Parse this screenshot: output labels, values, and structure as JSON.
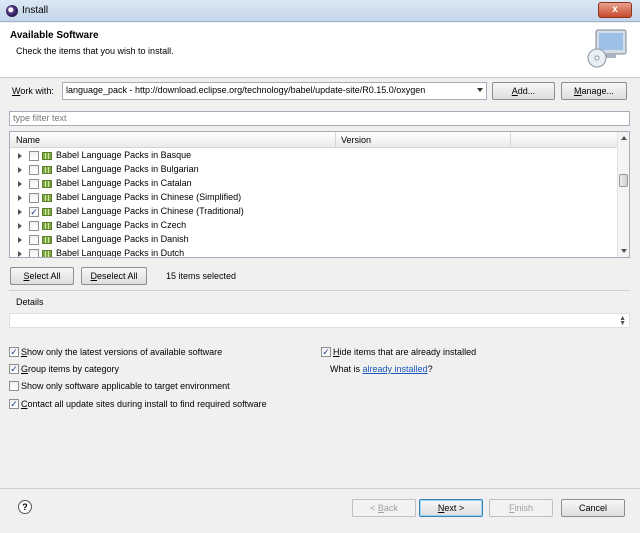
{
  "window": {
    "title": "Install",
    "close_label": "x"
  },
  "header": {
    "title": "Available Software",
    "description": "Check the items that you wish to install."
  },
  "work_with": {
    "label_prefix": "W",
    "label_rest": "ork with:",
    "value": "language_pack - http://download.eclipse.org/technology/babel/update-site/R0.15.0/oxygen",
    "add_button_prefix": "A",
    "add_button_rest": "dd...",
    "manage_button_prefix": "M",
    "manage_button_rest": "anage..."
  },
  "filter": {
    "placeholder": "type filter text"
  },
  "tree": {
    "columns": [
      "Name",
      "Version"
    ],
    "rows": [
      {
        "label": "Babel Language Packs in Basque",
        "checked": ""
      },
      {
        "label": "Babel Language Packs in Bulgarian",
        "checked": ""
      },
      {
        "label": "Babel Language Packs in Catalan",
        "checked": ""
      },
      {
        "label": "Babel Language Packs in Chinese (Simplified)",
        "checked": ""
      },
      {
        "label": "Babel Language Packs in Chinese (Traditional)",
        "checked": "✓"
      },
      {
        "label": "Babel Language Packs in Czech",
        "checked": ""
      },
      {
        "label": "Babel Language Packs in Danish",
        "checked": ""
      },
      {
        "label": "Babel Language Packs in Dutch",
        "checked": ""
      }
    ]
  },
  "selection": {
    "select_all_prefix": "S",
    "select_all_rest": "elect All",
    "deselect_all_prefix": "D",
    "deselect_all_rest": "eselect All",
    "status": "15 items selected"
  },
  "details": {
    "label": "Details"
  },
  "options": {
    "latest_versions": {
      "prefix": "S",
      "rest": "how only the latest versions of available software",
      "checked": "✓"
    },
    "group_by_category": {
      "prefix": "G",
      "rest": "roup items by category",
      "checked": "✓"
    },
    "target_env": {
      "prefix": "",
      "rest": "Show only software applicable to target environment",
      "checked": ""
    },
    "contact_sites": {
      "prefix": "C",
      "rest": "ontact all update sites during install to find required software",
      "checked": "✓"
    },
    "hide_installed": {
      "prefix": "H",
      "rest": "ide items that are already installed",
      "checked": "✓"
    },
    "what_is_prefix": "What is ",
    "what_is_link": "already installed",
    "what_is_suffix": "?"
  },
  "footer": {
    "help_icon": "?",
    "back_arrow": "< ",
    "back_prefix": "B",
    "back_rest": "ack",
    "next_prefix": "N",
    "next_rest": "ext",
    "next_arrow": " >",
    "finish_prefix": "F",
    "finish_rest": "inish",
    "cancel_label": "Cancel"
  },
  "colors": {
    "accent": "#3c7fb1",
    "link": "#1a57b8"
  }
}
